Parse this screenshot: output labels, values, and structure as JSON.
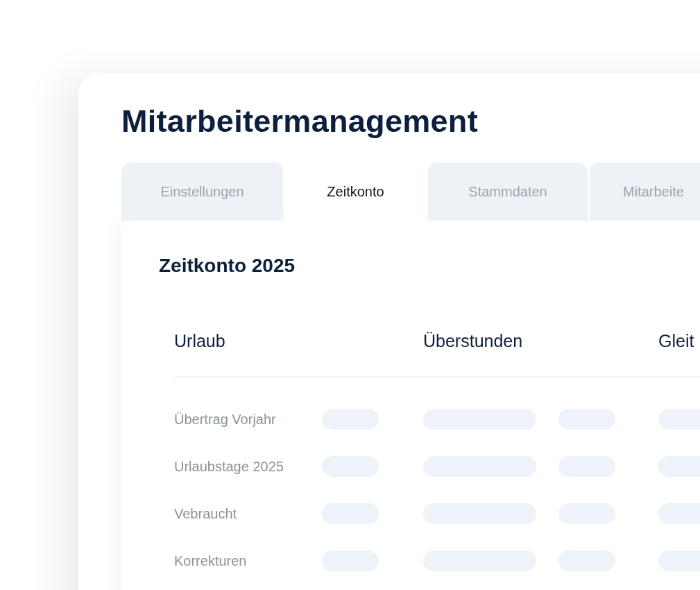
{
  "title": "Mitarbeitermanagement",
  "tabs": [
    {
      "label": "Einstellungen",
      "selected": false
    },
    {
      "label": "Zeitkonto",
      "selected": true
    },
    {
      "label": "Stammdaten",
      "selected": false
    },
    {
      "label": "Mitarbeite",
      "selected": false
    }
  ],
  "panel": {
    "heading": "Zeitkonto 2025",
    "columns": [
      "Urlaub",
      "Überstunden",
      "Gleit"
    ],
    "rows": [
      "Übertrag Vorjahr",
      "Urlaubstage 2025",
      "Vebraucht",
      "Korrekturen"
    ]
  }
}
